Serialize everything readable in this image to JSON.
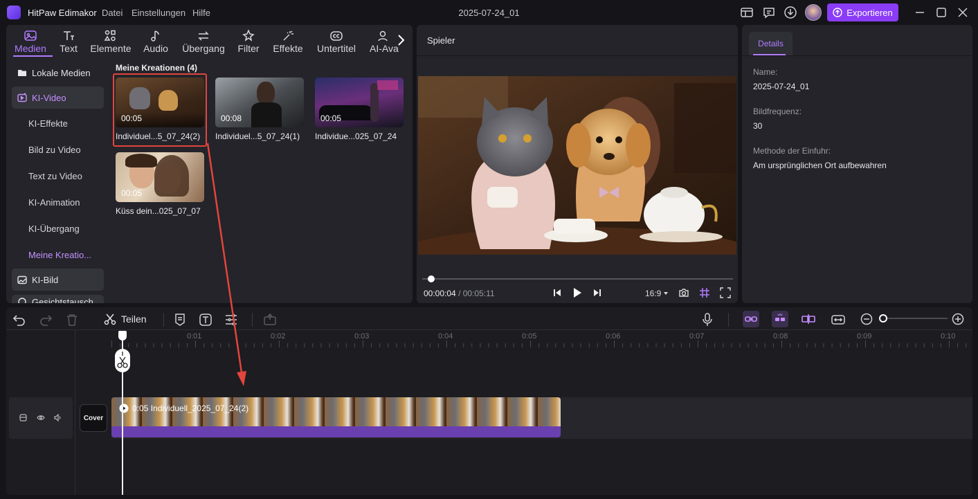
{
  "app": {
    "name": "HitPaw Edimakor",
    "menus": [
      "Datei",
      "Einstellungen",
      "Hilfe"
    ],
    "document_title": "2025-07-24_01",
    "export_label": "Exportieren"
  },
  "media_panel": {
    "tabs": [
      {
        "label": "Medien",
        "icon": "media-icon",
        "active": true
      },
      {
        "label": "Text",
        "icon": "text-icon"
      },
      {
        "label": "Elemente",
        "icon": "elements-icon"
      },
      {
        "label": "Audio",
        "icon": "audio-icon"
      },
      {
        "label": "Übergang",
        "icon": "transition-icon"
      },
      {
        "label": "Filter",
        "icon": "filter-icon"
      },
      {
        "label": "Effekte",
        "icon": "effects-icon"
      },
      {
        "label": "Untertitel",
        "icon": "subtitles-icon"
      },
      {
        "label": "AI-Ava",
        "icon": "ai-avatar-icon"
      }
    ],
    "sidebar": {
      "lokale_medien": "Lokale Medien",
      "ki_video": "KI-Video",
      "sub_items": [
        "KI-Effekte",
        "Bild zu Video",
        "Text zu Video",
        "KI-Animation",
        "KI-Übergang",
        "Meine Kreatio..."
      ],
      "ki_bild": "KI-Bild",
      "partial": "Gesichtstausch"
    },
    "section_title": "Meine Kreationen (4)",
    "items": [
      {
        "duration": "00:05",
        "label": "Individuel...5_07_24(2)",
        "selected": true
      },
      {
        "duration": "00:08",
        "label": "Individuel...5_07_24(1)"
      },
      {
        "duration": "00:05",
        "label": "Individue...025_07_24"
      },
      {
        "duration": "00:05",
        "label": "Küss dein...025_07_07"
      }
    ]
  },
  "player": {
    "title": "Spieler",
    "current_time": "00:00:04",
    "separator": "/",
    "total_time": "00:05:11",
    "aspect_ratio": "16:9",
    "progress": 0.01
  },
  "details": {
    "tab": "Details",
    "name_label": "Name:",
    "name_value": "2025-07-24_01",
    "fps_label": "Bildfrequenz:",
    "fps_value": "30",
    "import_label": "Methode der Einfuhr:",
    "import_value": "Am ursprünglichen Ort aufbewahren"
  },
  "timeline": {
    "split_label": "Teilen",
    "ruler": [
      "0:01",
      "0:02",
      "0:03",
      "0:04",
      "0:05",
      "0:06",
      "0:07",
      "0:08",
      "0:09",
      "0:10"
    ],
    "cover_label": "Cover",
    "clip_label": "0:05 Individuell_2025_07_24(2)"
  },
  "colors": {
    "accent": "#8b3cf6",
    "accent_text": "#b27cff",
    "selection_border": "#e2453c",
    "clip_bar": "#6a3fb0"
  }
}
